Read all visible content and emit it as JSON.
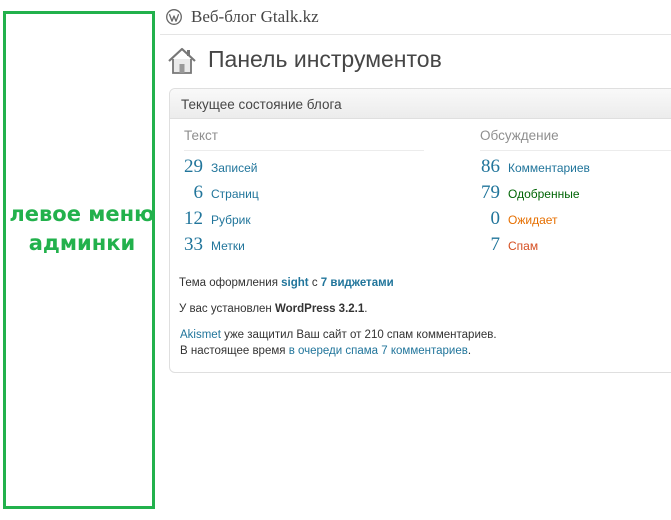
{
  "header": {
    "site_title": "Веб-блог Gtalk.kz"
  },
  "page": {
    "title": "Панель инструментов"
  },
  "annotation": {
    "line1": "левое меню",
    "line2": "админки",
    "color": "#22b14c"
  },
  "widget": {
    "title": "Текущее состояние блога",
    "content": {
      "heading": "Текст",
      "rows": [
        {
          "num": "29",
          "label": "Записей"
        },
        {
          "num": "6",
          "label": "Страниц"
        },
        {
          "num": "12",
          "label": "Рубрик"
        },
        {
          "num": "33",
          "label": "Метки"
        }
      ]
    },
    "discussion": {
      "heading": "Обсуждение",
      "rows": [
        {
          "num": "86",
          "label": "Комментариев",
          "color": "#21759b"
        },
        {
          "num": "79",
          "label": "Одобренные",
          "color": "#006505"
        },
        {
          "num": "0",
          "label": "Ожидает",
          "color": "#e66f00"
        },
        {
          "num": "7",
          "label": "Спам",
          "color": "#d54e21"
        }
      ]
    },
    "theme_line": {
      "prefix": "Тема оформления",
      "theme": "sight",
      "mid": "с",
      "widgets": "7 виджетами"
    },
    "version_line": {
      "prefix": "У вас установлен",
      "version": "WordPress 3.2.1",
      "suffix": "."
    },
    "akismet": {
      "link": "Akismet",
      "text": "уже защитил Ваш сайт от 210 спам комментариев.",
      "line2_prefix": "В настоящее время",
      "line2_link": "в очереди спама 7 комментариев",
      "line2_suffix": "."
    }
  },
  "colors": {
    "link": "#21759b",
    "approved": "#006505",
    "pending": "#e66f00",
    "spam": "#d54e21"
  }
}
